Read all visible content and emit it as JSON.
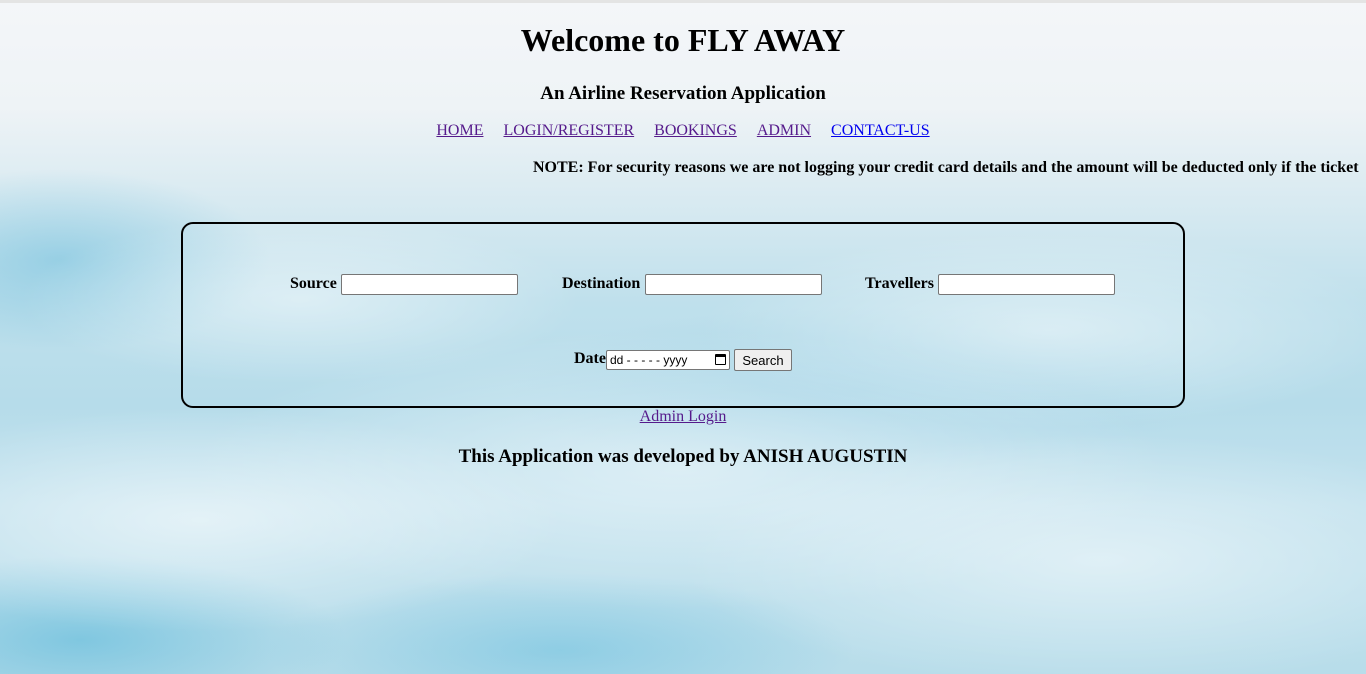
{
  "header": {
    "title": "Welcome to FLY AWAY",
    "subtitle": "An Airline Reservation Application"
  },
  "nav": {
    "items": [
      {
        "label": "HOME"
      },
      {
        "label": "LOGIN/REGISTER"
      },
      {
        "label": "BOOKINGS"
      },
      {
        "label": "ADMIN"
      },
      {
        "label": "CONTACT-US"
      }
    ]
  },
  "note": "NOTE: For security reasons we are not logging your credit card details and the amount will be deducted only if the ticket",
  "search_form": {
    "source_label": "Source",
    "source_value": "",
    "destination_label": "Destination",
    "destination_value": "",
    "travellers_label": "Travellers",
    "travellers_value": "",
    "date_label": "Date",
    "date_placeholder": "dd - - - - - yyyy",
    "search_button": "Search"
  },
  "admin_login_link": "Admin Login",
  "footer": {
    "credit": "This Application was developed by ANISH AUGUSTIN"
  },
  "colors": {
    "visited_link": "#551a8b",
    "unvisited_link": "#0000ee",
    "text": "#000000"
  }
}
